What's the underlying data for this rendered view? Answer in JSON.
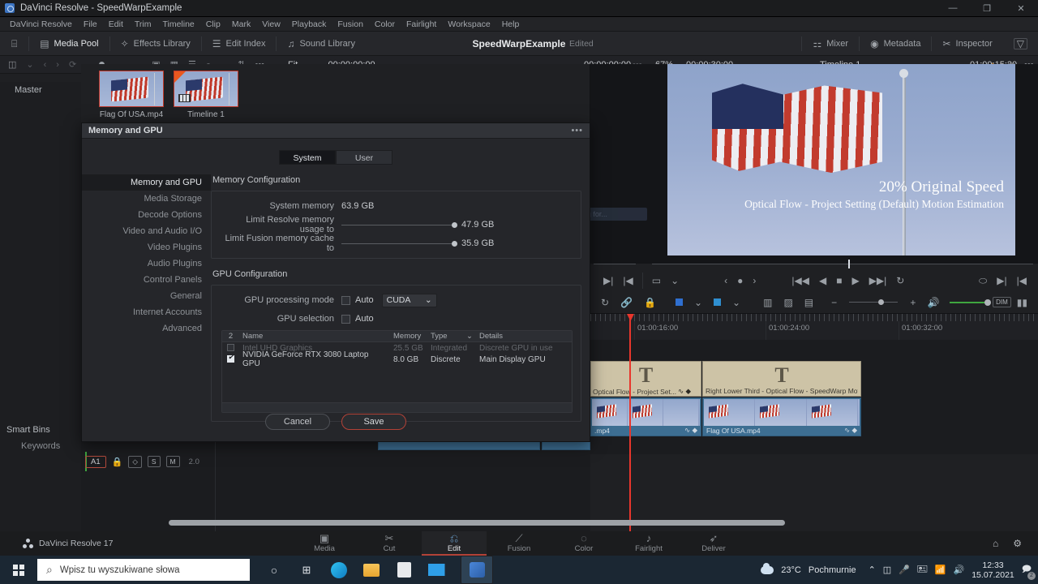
{
  "window": {
    "title": "DaVinci Resolve - SpeedWarpExample",
    "minimize": "—",
    "maximize": "❐",
    "close": "✕"
  },
  "menubar": [
    "DaVinci Resolve",
    "File",
    "Edit",
    "Trim",
    "Timeline",
    "Clip",
    "Mark",
    "View",
    "Playback",
    "Fusion",
    "Color",
    "Fairlight",
    "Workspace",
    "Help"
  ],
  "toolbar": {
    "home_icon": "⌸",
    "items": [
      {
        "label": "Media Pool",
        "icon": "media-pool-icon",
        "glyph": "▤"
      },
      {
        "label": "Effects Library",
        "icon": "effects-library-icon",
        "glyph": "✧"
      },
      {
        "label": "Edit Index",
        "icon": "edit-index-icon",
        "glyph": "☰"
      },
      {
        "label": "Sound Library",
        "icon": "sound-library-icon",
        "glyph": "♫"
      }
    ],
    "project_title": "SpeedWarpExample",
    "edited_label": "Edited",
    "right_items": [
      {
        "label": "Mixer",
        "icon": "mixer-icon",
        "glyph": "⚏"
      },
      {
        "label": "Metadata",
        "icon": "metadata-icon",
        "glyph": "◉"
      },
      {
        "label": "Inspector",
        "icon": "inspector-icon",
        "glyph": "✂"
      }
    ],
    "expand_glyph": "▽"
  },
  "mp_toolbar": {
    "panel_glyph": "◫",
    "chev": "⌄",
    "back": "‹",
    "forward": "›",
    "refresh": "⟳",
    "more": "…",
    "thumb_glyph": "▣",
    "grid_glyph": "▦",
    "list_glyph": "☰",
    "search_glyph": "⌕",
    "sort_glyph": "⇅",
    "options_glyph": "•••",
    "fit_label": "Fit",
    "timecode": "00:00:00:00"
  },
  "viewer_bar": {
    "timecode_left": "00:00:00:00",
    "more": "•••",
    "zoom": "67%",
    "duration": "00:00:30:00",
    "timeline_name": "Timeline 1",
    "timecode_right": "01:00:15:20",
    "color_glyph": "◕",
    "fullscreen_glyph": "▭",
    "options_glyph": "•••"
  },
  "sidebar": {
    "master": "Master",
    "smart_bins": "Smart Bins",
    "keywords": "Keywords"
  },
  "media_pool": {
    "clips": [
      {
        "name": "Flag Of USA.mp4",
        "type": "video"
      },
      {
        "name": "Timeline 1",
        "type": "timeline"
      }
    ]
  },
  "viewer": {
    "overlay_line1": "20% Original Speed",
    "overlay_line2": "Optical Flow - Project Setting (Default) Motion Estimation"
  },
  "transport": {
    "in_glyph": "▶|",
    "out_glyph": "|◀",
    "frame_glyph": "▭",
    "chev": "⌄",
    "prev_kf": "‹",
    "kf_dot": "●",
    "next_kf": "›",
    "first": "|◀◀",
    "rev": "◀",
    "stop": "■",
    "play": "▶",
    "fwd": "▶▶|",
    "loop": "↻",
    "safe": "⬭",
    "mark_in": "▶|",
    "mark_out": "|◀"
  },
  "tools": {
    "trim_glyph": "↻",
    "link_glyph": "🔗",
    "lock_glyph": "🔒",
    "flag_glyph": "⬛",
    "marker_glyph": "⬛",
    "snap1": "▥",
    "snap2": "▨",
    "snap3": "▤",
    "zoom_minus": "−",
    "zoom_plus": "+",
    "volume_glyph": "🔊",
    "dim_label": "DIM",
    "meter_glyph": "▮▮"
  },
  "timeline": {
    "ticks": [
      "01:00:16:00",
      "01:00:24:00",
      "01:00:32:00"
    ],
    "title_clips": [
      {
        "label": "Optical Flow - Project Set...",
        "glyph": "T",
        "icons": "∿ ◆"
      },
      {
        "label": "Right Lower Third - Optical Flow - SpeedWarp Motion ...",
        "glyph": "T",
        "icons": ""
      }
    ],
    "video_clips": [
      {
        "label": ".mp4",
        "icons": "∿ ◆"
      },
      {
        "label": "Flag Of USA.mp4",
        "icons": "∿ ◆"
      }
    ],
    "audio_track": {
      "name": "A1",
      "lock": "🔒",
      "link": "◇",
      "solo": "S",
      "mute": "M",
      "channels": "2.0"
    }
  },
  "dialog": {
    "title": "Memory and GPU",
    "more_glyph": "•••",
    "tabs": [
      {
        "label": "System",
        "active": true
      },
      {
        "label": "User",
        "active": false
      }
    ],
    "nav": [
      {
        "label": "Memory and GPU",
        "active": true
      },
      {
        "label": "Media Storage",
        "active": false
      },
      {
        "label": "Decode Options",
        "active": false
      },
      {
        "label": "Video and Audio I/O",
        "active": false
      },
      {
        "label": "Video Plugins",
        "active": false
      },
      {
        "label": "Audio Plugins",
        "active": false
      },
      {
        "label": "Control Panels",
        "active": false
      },
      {
        "label": "General",
        "active": false
      },
      {
        "label": "Internet Accounts",
        "active": false
      },
      {
        "label": "Advanced",
        "active": false
      }
    ],
    "memory_section": {
      "heading": "Memory Configuration",
      "system_memory_label": "System memory",
      "system_memory_value": "63.9 GB",
      "resolve_label": "Limit Resolve memory usage to",
      "resolve_value": "47.9 GB",
      "fusion_label": "Limit Fusion memory cache to",
      "fusion_value": "35.9 GB"
    },
    "gpu_section": {
      "heading": "GPU Configuration",
      "mode_label": "GPU processing mode",
      "mode_auto": "Auto",
      "mode_value": "CUDA",
      "mode_chevron": "⌄",
      "selection_label": "GPU selection",
      "selection_auto": "Auto",
      "table": {
        "columns": [
          "2",
          "Name",
          "Memory",
          "Type",
          "Details"
        ],
        "type_chevron": "⌄",
        "rows": [
          {
            "checked": false,
            "name": "Intel UHD Graphics",
            "memory": "25.5 GB",
            "type": "Integrated",
            "details": "Discrete GPU in use",
            "dimmed": true
          },
          {
            "checked": true,
            "name": "NVIDIA GeForce RTX 3080 Laptop GPU",
            "memory": "8.0 GB",
            "type": "Discrete",
            "details": "Main Display GPU",
            "dimmed": false
          }
        ]
      }
    },
    "cancel_label": "Cancel",
    "save_label": "Save",
    "ghost_tooltip": "Waiting for..."
  },
  "pagebar": {
    "product": "DaVinci Resolve 17",
    "pages": [
      {
        "label": "Media",
        "glyph": "▣",
        "active": false
      },
      {
        "label": "Cut",
        "glyph": "✂",
        "active": false
      },
      {
        "label": "Edit",
        "glyph": "⎌",
        "active": true
      },
      {
        "label": "Fusion",
        "glyph": "⟋",
        "active": false
      },
      {
        "label": "Color",
        "glyph": "◌",
        "active": false
      },
      {
        "label": "Fairlight",
        "glyph": "♪",
        "active": false
      },
      {
        "label": "Deliver",
        "glyph": "➶",
        "active": false
      }
    ],
    "home_glyph": "⌂",
    "settings_glyph": "⚙"
  },
  "taskbar": {
    "search_placeholder": "Wpisz tu wyszukiwane słowa",
    "search_glyph": "⌕",
    "cortana_glyph": "○",
    "taskview_glyph": "⊞",
    "apps": [
      "edge",
      "explorer",
      "store",
      "mail",
      "resolve"
    ],
    "weather_temp": "23°C",
    "weather_desc": "Pochmurnie",
    "tray_chevron": "⌃",
    "tray_glyphs": [
      "◫",
      "🎤",
      "🖭",
      "📶",
      "🔊"
    ],
    "time": "12:33",
    "date": "15.07.2021",
    "notif_glyph": "🗩",
    "notif_count": "2"
  }
}
